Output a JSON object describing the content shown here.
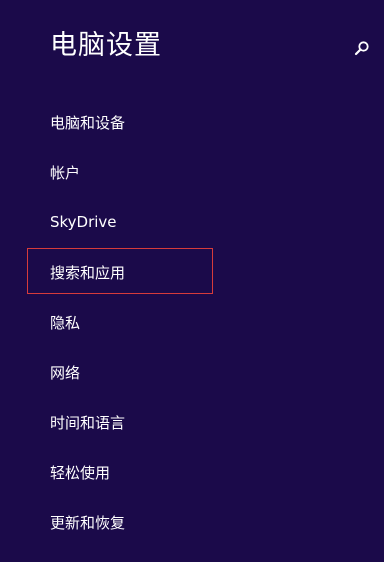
{
  "header": {
    "title": "电脑设置",
    "search_icon": "search-icon"
  },
  "colors": {
    "background": "#1b0a4a",
    "text": "#ffffff",
    "highlight_border": "#d63b3b"
  },
  "nav": {
    "items": [
      {
        "label": "电脑和设备"
      },
      {
        "label": "帐户"
      },
      {
        "label": "SkyDrive"
      },
      {
        "label": "搜索和应用",
        "highlighted": true
      },
      {
        "label": "隐私"
      },
      {
        "label": "网络"
      },
      {
        "label": "时间和语言"
      },
      {
        "label": "轻松使用"
      },
      {
        "label": "更新和恢复"
      }
    ]
  }
}
